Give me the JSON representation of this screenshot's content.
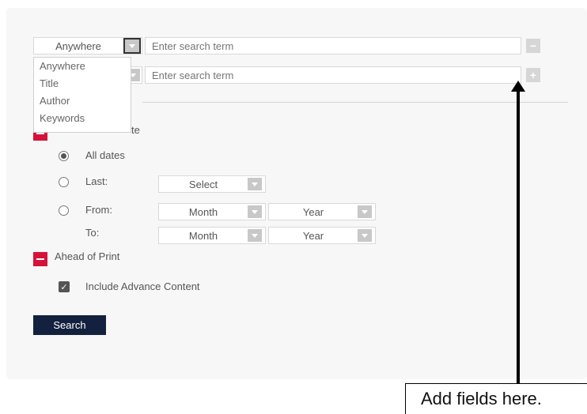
{
  "search_rows": [
    {
      "field": "Anywhere",
      "placeholder": "Enter search term",
      "action": "−"
    },
    {
      "field": "",
      "placeholder": "Enter search term",
      "action": "+"
    }
  ],
  "field_dropdown": {
    "options": [
      "Anywhere",
      "Title",
      "Author",
      "Keywords"
    ]
  },
  "date_section": {
    "title_visible_fragment": "te",
    "options": {
      "all_dates": "All dates",
      "last": "Last:",
      "from": "From:",
      "to": "To:"
    },
    "last_select": "Select",
    "from_month": "Month",
    "from_year": "Year",
    "to_month": "Month",
    "to_year": "Year",
    "selected": "all_dates"
  },
  "ahead_of_print": {
    "title": "Ahead of Print",
    "include_label": "Include Advance Content",
    "checked": true
  },
  "search_button": "Search",
  "annotation": {
    "text": "Add fields here."
  },
  "colors": {
    "accent_red": "#d5133a",
    "button_navy": "#13213f"
  }
}
